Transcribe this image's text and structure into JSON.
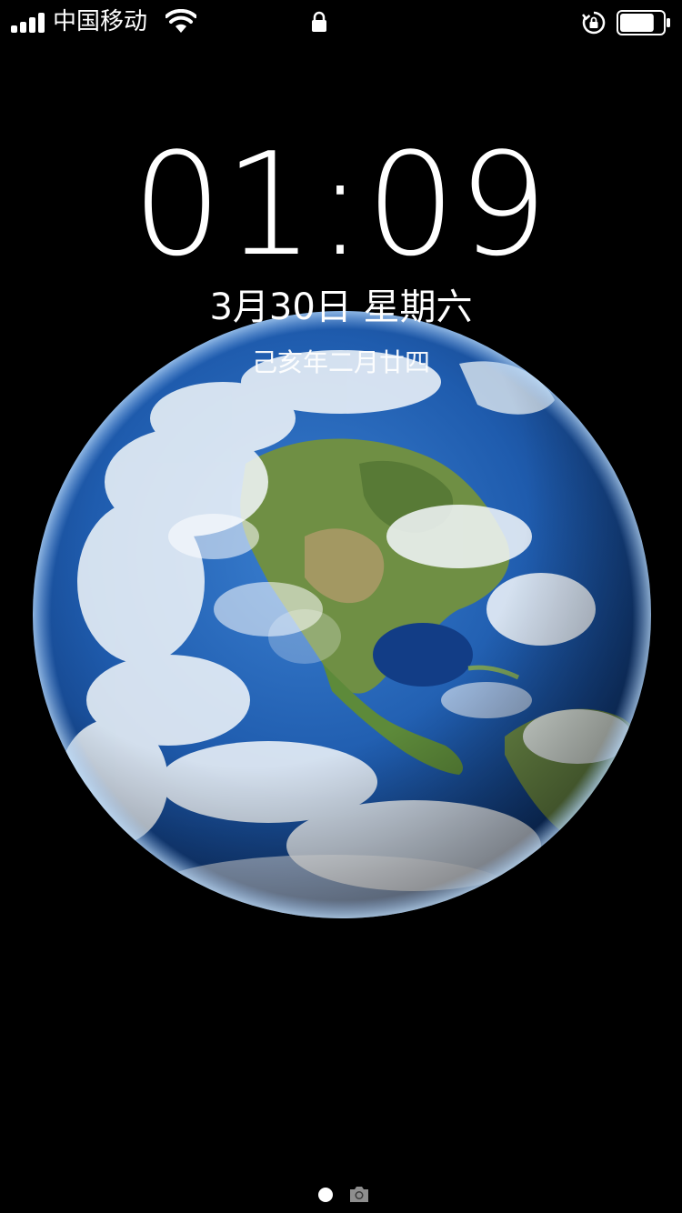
{
  "status_bar": {
    "carrier": "中国移动",
    "signal_bars": 4,
    "battery_level": 0.8,
    "icons": [
      "signal-icon",
      "wifi-icon",
      "lock-icon",
      "rotation-lock-icon",
      "battery-icon"
    ]
  },
  "lockscreen": {
    "time": "01:09",
    "date": "3月30日 星期六",
    "lunar_date": "己亥年二月廿四"
  },
  "wallpaper": {
    "subject": "earth-icon",
    "colors": {
      "ocean": "#1d4f9c",
      "land": "#6b8a3e",
      "cloud": "#f4f8fb",
      "background": "#000000"
    }
  },
  "page_indicator": {
    "pages": 1,
    "current": 1,
    "icons": [
      "page-dot-icon",
      "camera-icon"
    ]
  }
}
